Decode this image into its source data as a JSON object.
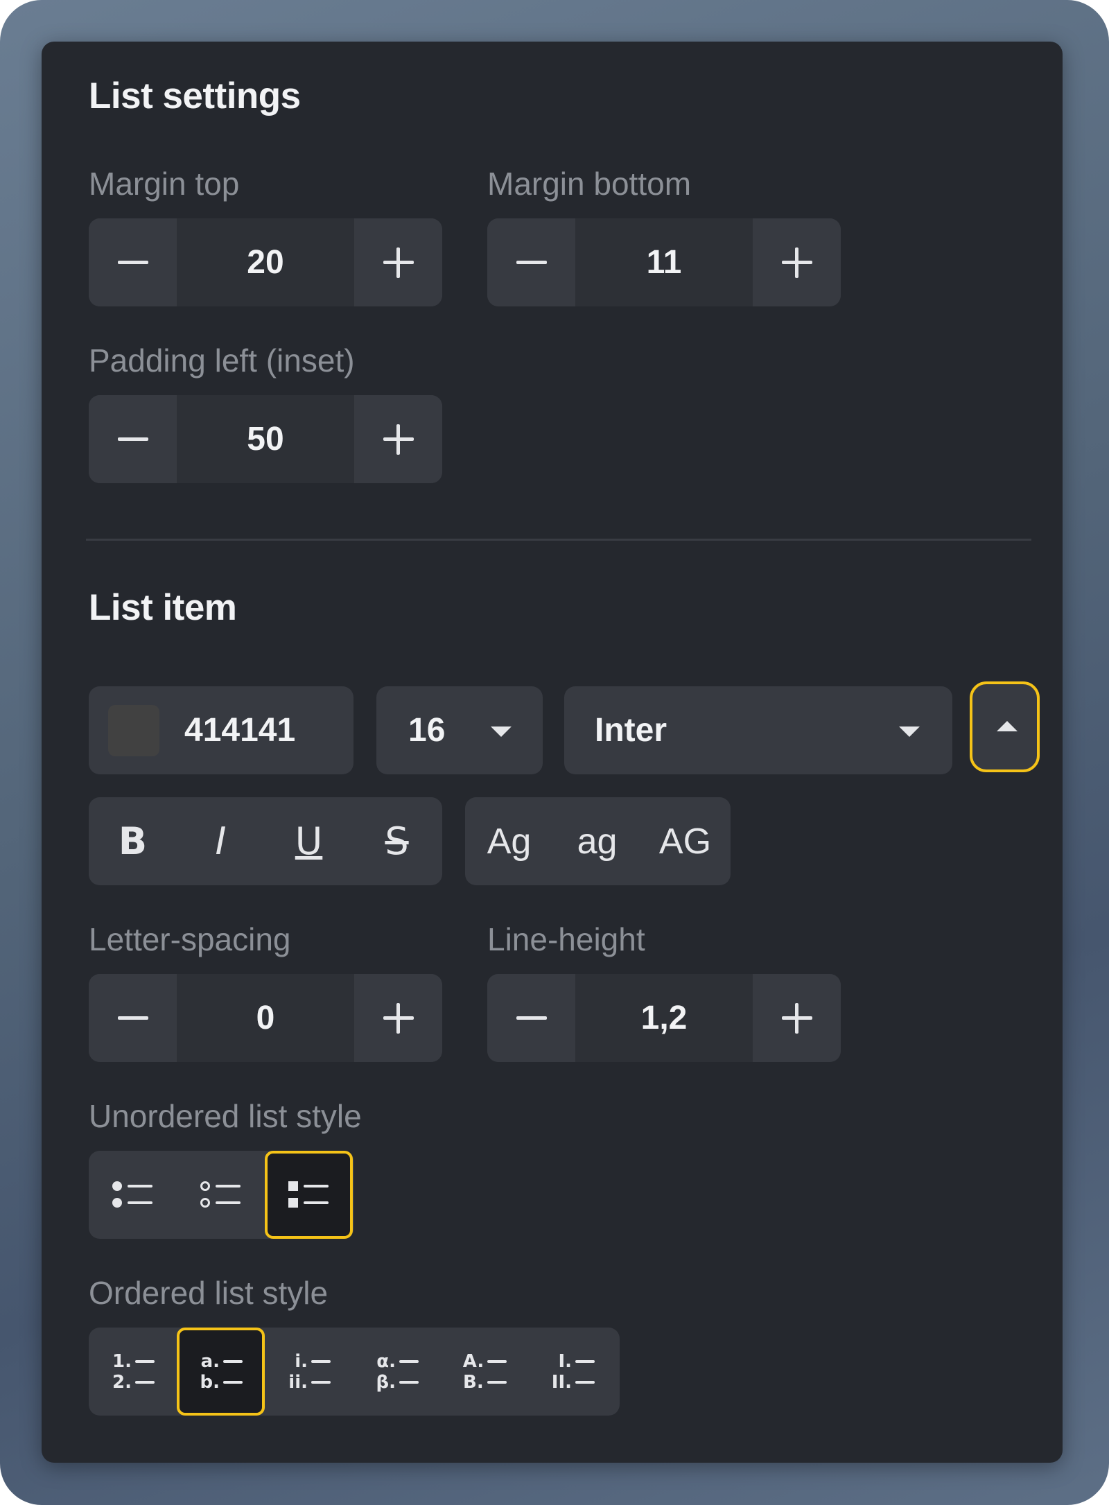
{
  "list_settings": {
    "title": "List settings",
    "margin_top": {
      "label": "Margin top",
      "value": "20"
    },
    "margin_bottom": {
      "label": "Margin bottom",
      "value": "11"
    },
    "padding_left": {
      "label": "Padding left (inset)",
      "value": "50"
    }
  },
  "list_item": {
    "title": "List item",
    "color": {
      "hex": "414141",
      "swatch": "#414141"
    },
    "font_size": "16",
    "font_family": "Inter",
    "format_buttons": [
      "B",
      "I",
      "U",
      "S"
    ],
    "case_buttons": [
      "Ag",
      "ag",
      "AG"
    ],
    "letter_spacing": {
      "label": "Letter-spacing",
      "value": "0"
    },
    "line_height": {
      "label": "Line-height",
      "value": "1,2"
    },
    "unordered": {
      "label": "Unordered list style",
      "options": [
        "filled-circle-bullets-icon",
        "hollow-circle-bullets-icon",
        "square-bullets-icon"
      ],
      "selected_index": 2
    },
    "ordered": {
      "label": "Ordered list style",
      "options": [
        {
          "l1": "1.",
          "l2": "2."
        },
        {
          "l1": "a.",
          "l2": "b."
        },
        {
          "l1": "i.",
          "l2": "ii."
        },
        {
          "l1": "α.",
          "l2": "β."
        },
        {
          "l1": "A.",
          "l2": "B."
        },
        {
          "l1": "I.",
          "l2": "II."
        }
      ],
      "selected_index": 1
    }
  },
  "colors": {
    "accent": "#f5c318",
    "panel": "#25282e",
    "control": "#373a41"
  }
}
